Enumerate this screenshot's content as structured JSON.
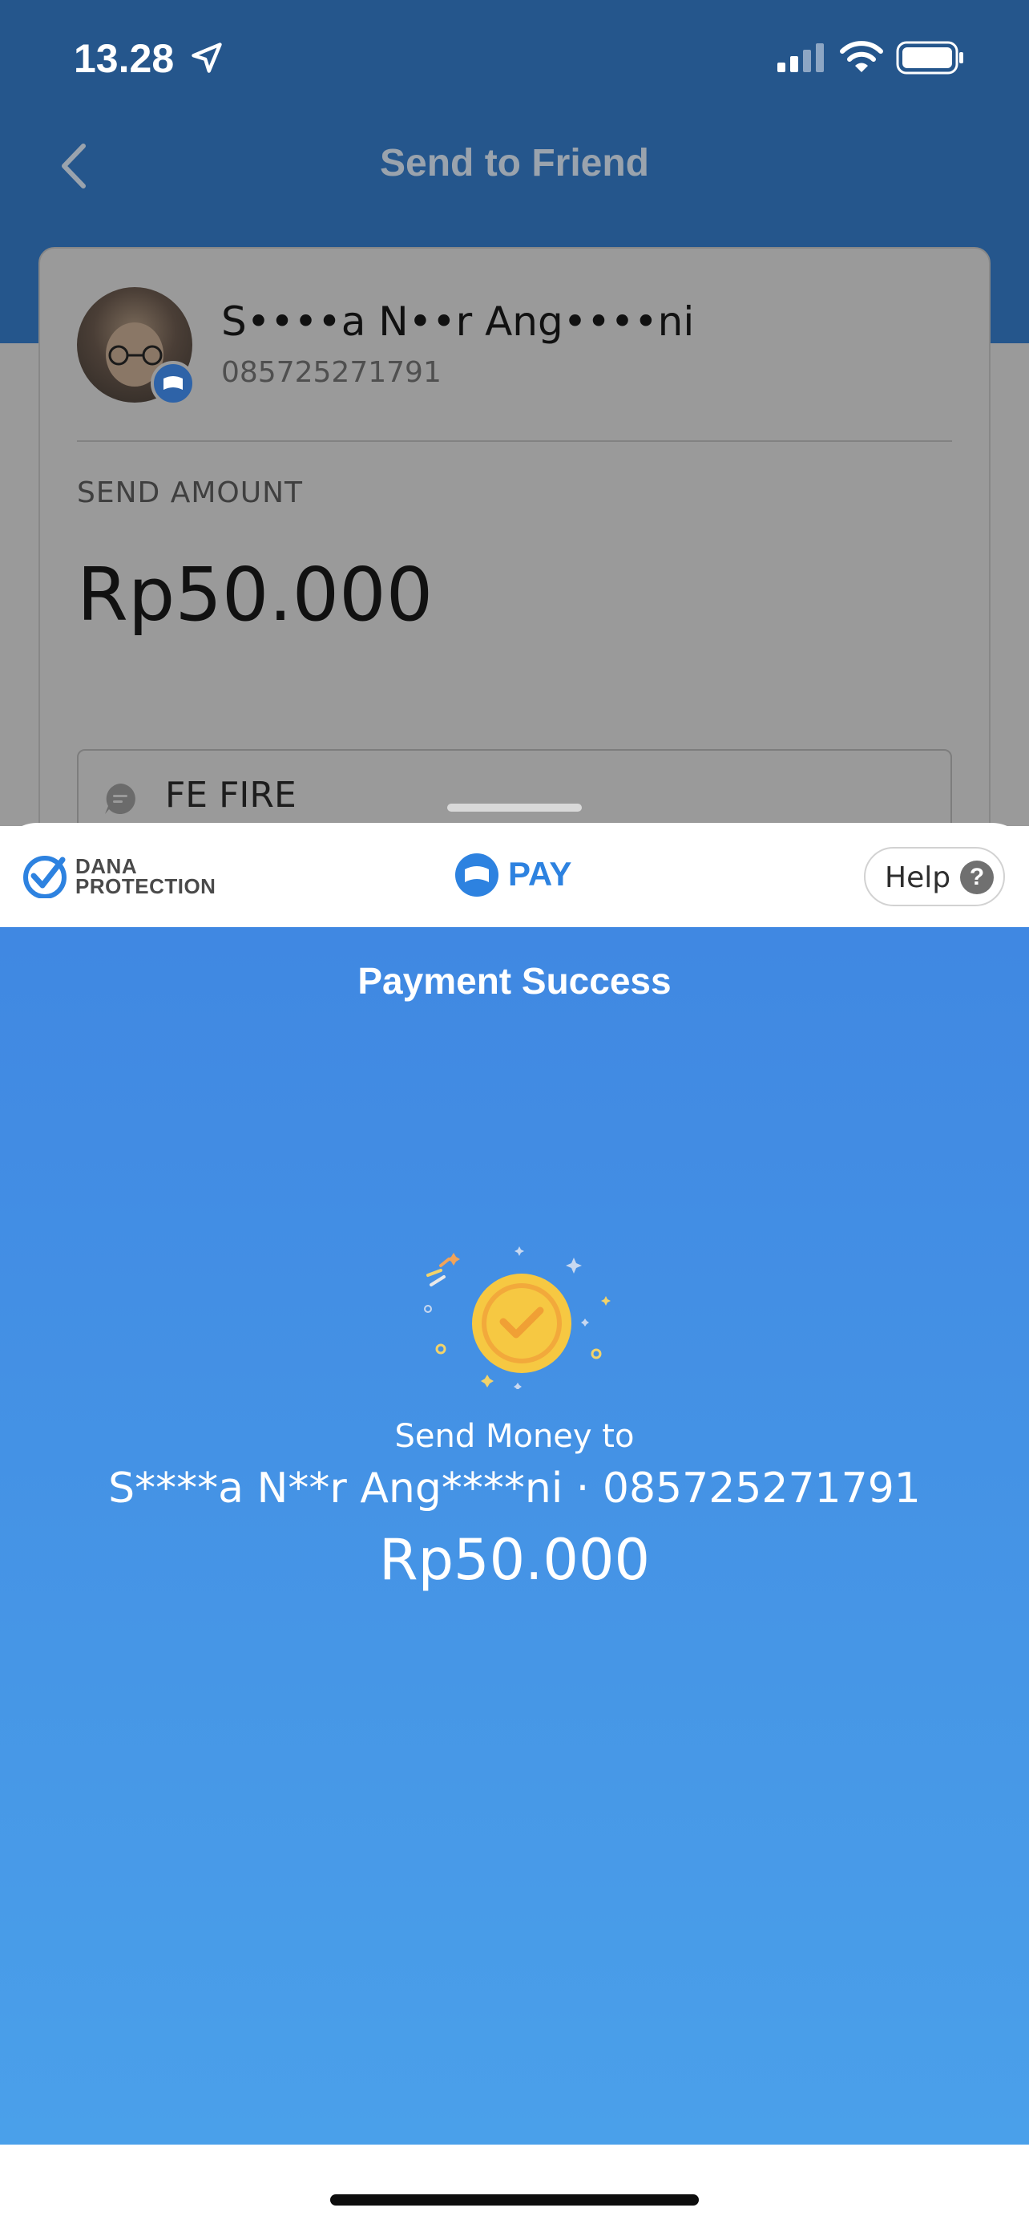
{
  "status_bar": {
    "time": "13.28"
  },
  "nav": {
    "title": "Send to Friend"
  },
  "recipient": {
    "name": "S••••a N••r Ang••••ni",
    "phone": "085725271791"
  },
  "send": {
    "amount_label": "SEND AMOUNT",
    "amount_value": "Rp50.000",
    "note": "FE FIRE"
  },
  "sheet": {
    "protection_line1": "DANA",
    "protection_line2": "PROTECTION",
    "pay_label": "PAY",
    "help_label": "Help",
    "help_icon_glyph": "?"
  },
  "success": {
    "title": "Payment Success",
    "send_money_to": "Send Money to",
    "receiver_name": "S****a N**r Ang****ni",
    "separator": "·",
    "receiver_phone": "085725271791",
    "amount": "Rp50.000"
  },
  "colors": {
    "header_blue": "#25568c",
    "success_blue": "#4088e2",
    "pay_blue": "#2d82e0",
    "coin_gold": "#f6c842"
  },
  "icons": {
    "back": "chevron-left-icon",
    "location": "location-arrow-icon",
    "signal": "cellular-signal-icon",
    "wifi": "wifi-icon",
    "battery": "battery-icon",
    "note": "chat-bubble-icon",
    "protection": "shield-check-icon",
    "pay": "dana-wallet-icon",
    "help": "question-mark-icon",
    "success": "gold-coin-check-icon"
  }
}
